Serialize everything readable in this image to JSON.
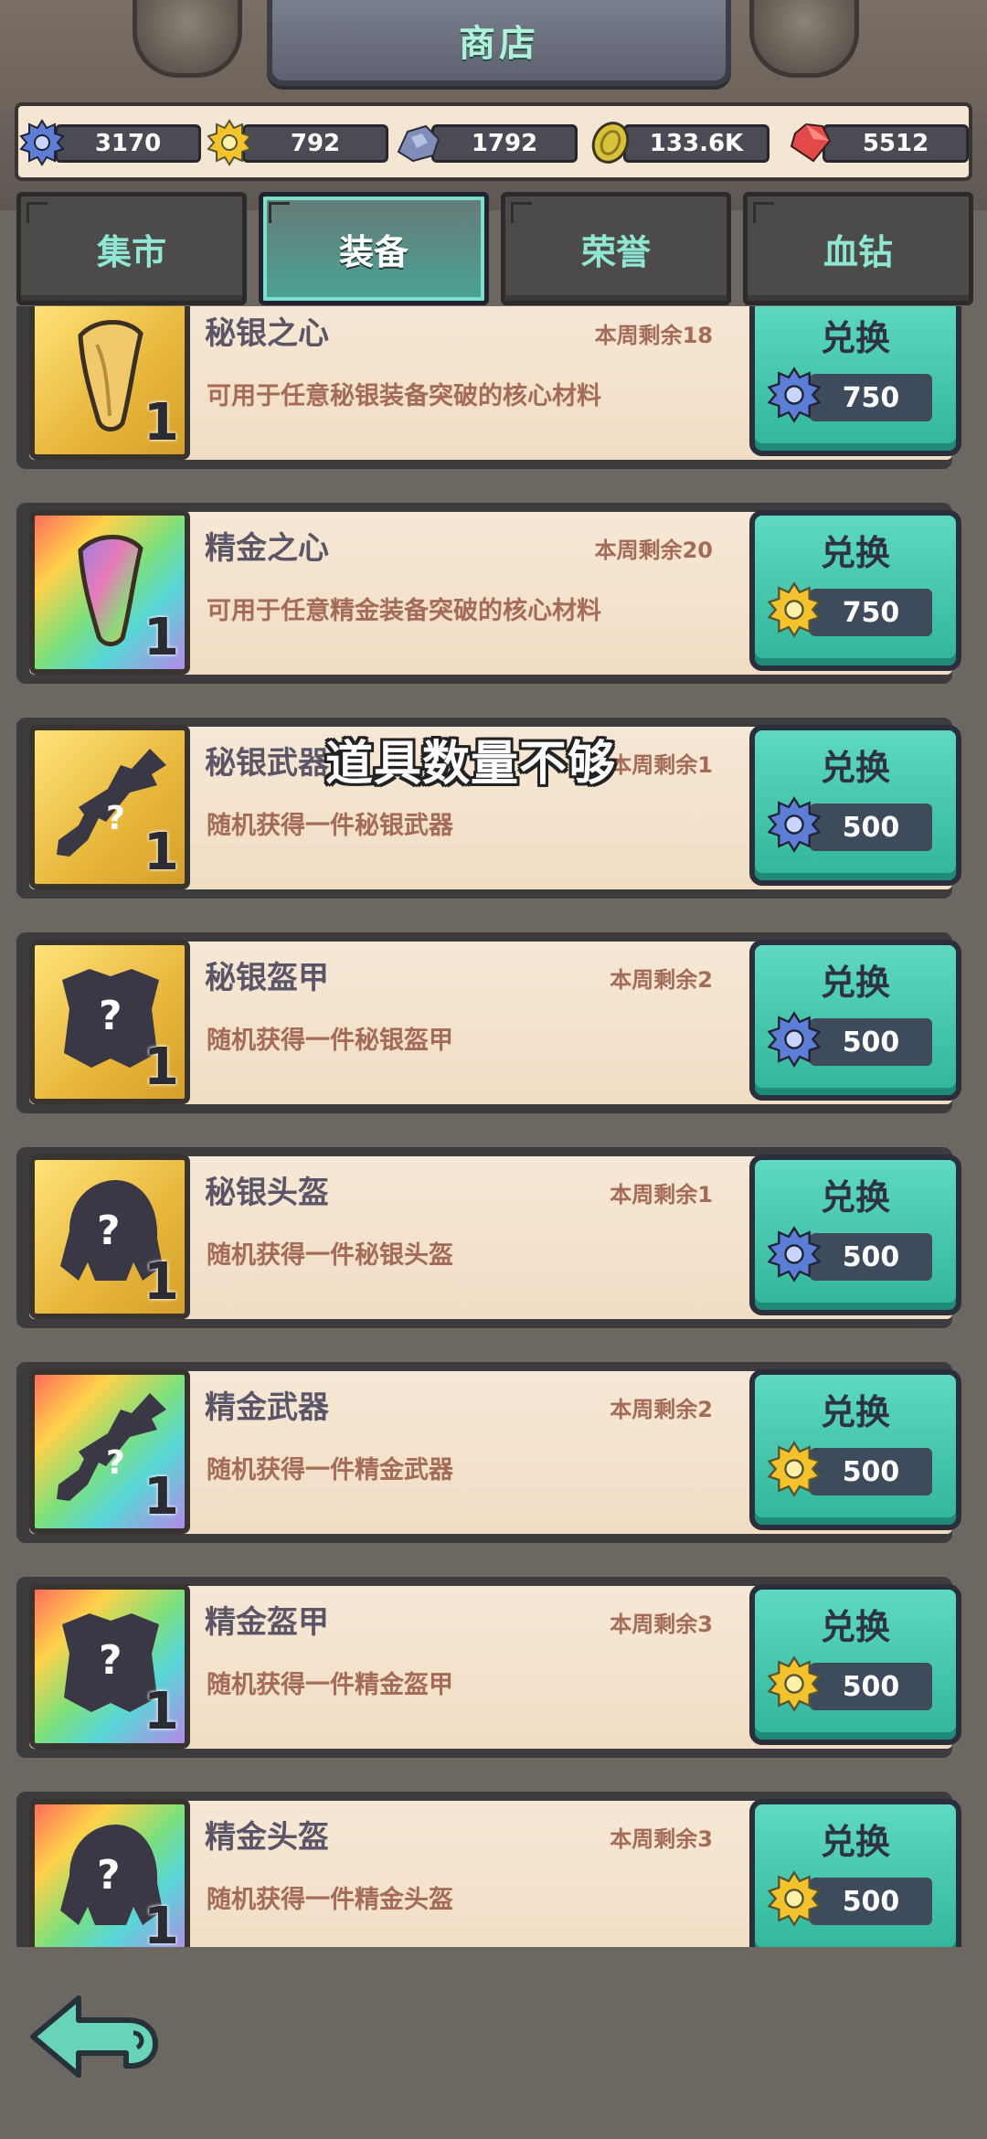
{
  "header": {
    "title": "商店"
  },
  "currencies": [
    {
      "icon": "blue-gear-token-icon",
      "value": "3170"
    },
    {
      "icon": "gold-gear-token-icon",
      "value": "792"
    },
    {
      "icon": "ore-stone-icon",
      "value": "1792"
    },
    {
      "icon": "gold-coin-icon",
      "value": "133.6K"
    },
    {
      "icon": "red-gem-icon",
      "value": "5512"
    }
  ],
  "tabs": [
    {
      "label": "集市",
      "active": false
    },
    {
      "label": "装备",
      "active": true
    },
    {
      "label": "荣誉",
      "active": false
    },
    {
      "label": "血钻",
      "active": false
    }
  ],
  "items": [
    {
      "name": "秘银之心",
      "remaining": "本周剩余18",
      "desc": "可用于任意秘银装备突破的核心材料",
      "qty": "1",
      "tier": "silver",
      "thumb": "claw-icon",
      "button": "兑换",
      "cost_icon": "blue-gear-token-icon",
      "cost": "750"
    },
    {
      "name": "精金之心",
      "remaining": "本周剩余20",
      "desc": "可用于任意精金装备突破的核心材料",
      "qty": "1",
      "tier": "gold",
      "thumb": "rainbow-claw-icon",
      "button": "兑换",
      "cost_icon": "gold-gear-token-icon",
      "cost": "750"
    },
    {
      "name": "秘银武器",
      "remaining": "本周剩余1",
      "desc": "随机获得一件秘银武器",
      "qty": "1",
      "tier": "silver",
      "thumb": "mystery-weapon-icon",
      "button": "兑换",
      "cost_icon": "blue-gear-token-icon",
      "cost": "500"
    },
    {
      "name": "秘银盔甲",
      "remaining": "本周剩余2",
      "desc": "随机获得一件秘银盔甲",
      "qty": "1",
      "tier": "silver",
      "thumb": "mystery-armor-icon",
      "button": "兑换",
      "cost_icon": "blue-gear-token-icon",
      "cost": "500"
    },
    {
      "name": "秘银头盔",
      "remaining": "本周剩余1",
      "desc": "随机获得一件秘银头盔",
      "qty": "1",
      "tier": "silver",
      "thumb": "mystery-helmet-icon",
      "button": "兑换",
      "cost_icon": "blue-gear-token-icon",
      "cost": "500"
    },
    {
      "name": "精金武器",
      "remaining": "本周剩余2",
      "desc": "随机获得一件精金武器",
      "qty": "1",
      "tier": "gold",
      "thumb": "mystery-weapon-icon",
      "button": "兑换",
      "cost_icon": "gold-gear-token-icon",
      "cost": "500"
    },
    {
      "name": "精金盔甲",
      "remaining": "本周剩余3",
      "desc": "随机获得一件精金盔甲",
      "qty": "1",
      "tier": "gold",
      "thumb": "mystery-armor-icon",
      "button": "兑换",
      "cost_icon": "gold-gear-token-icon",
      "cost": "500"
    },
    {
      "name": "精金头盔",
      "remaining": "本周剩余3",
      "desc": "随机获得一件精金头盔",
      "qty": "1",
      "tier": "gold",
      "thumb": "mystery-helmet-icon",
      "button": "兑换",
      "cost_icon": "gold-gear-token-icon",
      "cost": "500"
    }
  ],
  "toast": "道具数量不够",
  "colors": {
    "accent": "#3fc4a8",
    "card_bg": "#f4e4d0",
    "text_brown": "#a46b57",
    "text_dark": "#5a5667"
  }
}
